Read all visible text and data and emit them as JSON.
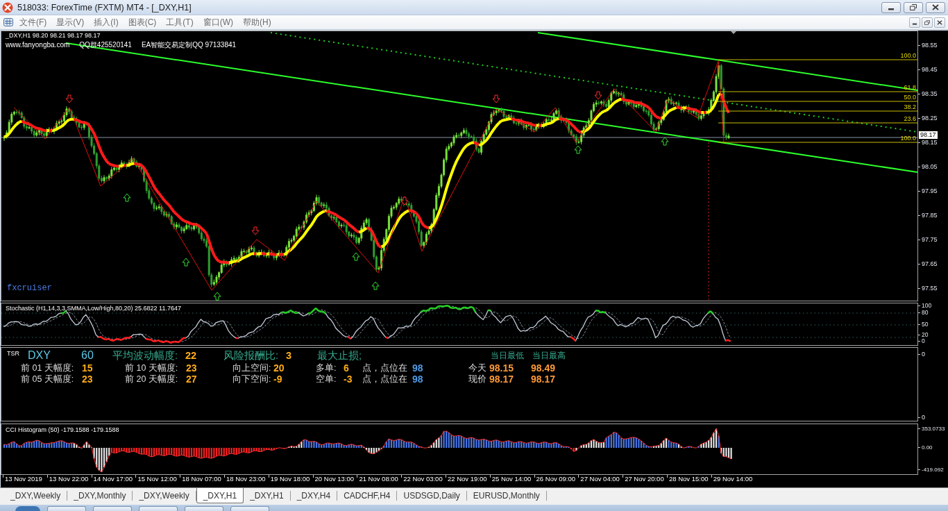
{
  "window": {
    "title": "518033: ForexTime (FXTM) MT4 - [_DXY,H1]"
  },
  "menu": [
    "文件(F)",
    "显示(V)",
    "插入(I)",
    "图表(C)",
    "工具(T)",
    "窗口(W)",
    "帮助(H)"
  ],
  "chart": {
    "header": "_DXY,H1 98.20 98.21 98.17 98.17",
    "ad_texts": [
      "www.fanyongba.com",
      "QQ群425520141",
      "EA智能交易定制QQ 97133841"
    ],
    "signature": "fxcruiser",
    "fibonacci_levels": [
      "100.0",
      "61.8",
      "50.0",
      "38.2",
      "23.6",
      "100.0"
    ],
    "price_scale": [
      "98.55",
      "98.45",
      "98.35",
      "98.25",
      "98.15",
      "98.05",
      "97.95",
      "97.85",
      "97.75",
      "97.65",
      "97.55"
    ],
    "current_price": "98.17"
  },
  "stochastic": {
    "title": "Stochastic (H1,14,3,3,SMMA,Low/High,80,20) 25.6822 11.7647",
    "scale": [
      "100",
      "80",
      "50",
      "20",
      "0"
    ]
  },
  "tsr": {
    "label": "TSR",
    "symbol": "DXY",
    "period": "60",
    "stats": [
      {
        "label": "平均波动幅度:",
        "value": "22"
      },
      {
        "label": "风险报酬比:",
        "value": "3"
      },
      {
        "label": "最大止损;"
      }
    ],
    "day_headers": [
      "当日最低",
      "当日最高"
    ],
    "rows": [
      {
        "ranges": [
          {
            "label": "前 01 天幅度:",
            "value": "15"
          },
          {
            "label": "前 10 天幅度:",
            "value": "23"
          }
        ],
        "space": {
          "label": "向上空间:",
          "value": "20"
        },
        "stop": {
          "label": "多单:",
          "value": "6",
          "unit": "点，点位在",
          "price": "98"
        },
        "day": {
          "label": "今天",
          "low": "98.15",
          "high": "98.49"
        }
      },
      {
        "ranges": [
          {
            "label": "前 05 天幅度:",
            "value": "23"
          },
          {
            "label": "前 20 天幅度:",
            "value": "27"
          }
        ],
        "space": {
          "label": "向下空间:",
          "value": "-9"
        },
        "stop": {
          "label": "空单:",
          "value": "-3",
          "unit": "点，点位在",
          "price": "98"
        },
        "day": {
          "label": "现价",
          "low": "98.17",
          "high": "98.17"
        }
      }
    ],
    "scale": [
      "0",
      "0"
    ]
  },
  "cci": {
    "title": "CCI Histogram (50) -179.1588 -179.1588",
    "scale": [
      "353.0733",
      "0.00",
      "-419.092"
    ]
  },
  "time_axis": [
    "13 Nov 2019",
    "13 Nov 22:00",
    "14 Nov 17:00",
    "15 Nov 12:00",
    "18 Nov 07:00",
    "18 Nov 23:00",
    "19 Nov 18:00",
    "20 Nov 13:00",
    "21 Nov 08:00",
    "22 Nov 03:00",
    "22 Nov 19:00",
    "25 Nov 14:00",
    "26 Nov 09:00",
    "27 Nov 04:00",
    "27 Nov 20:00",
    "28 Nov 15:00",
    "29 Nov 14:00"
  ],
  "tabs": [
    {
      "label": "_DXY,Weekly",
      "selected": false
    },
    {
      "label": "_DXY,Monthly",
      "selected": false
    },
    {
      "label": "_DXY,Weekly",
      "selected": false
    },
    {
      "label": "_DXY,H1",
      "selected": true
    },
    {
      "label": "_DXY,H1",
      "selected": false
    },
    {
      "label": "_DXY,H4",
      "selected": false
    },
    {
      "label": "CADCHF,H4",
      "selected": false
    },
    {
      "label": "USDSGD,Daily",
      "selected": false
    },
    {
      "label": "EURUSD,Monthly",
      "selected": false
    }
  ]
}
